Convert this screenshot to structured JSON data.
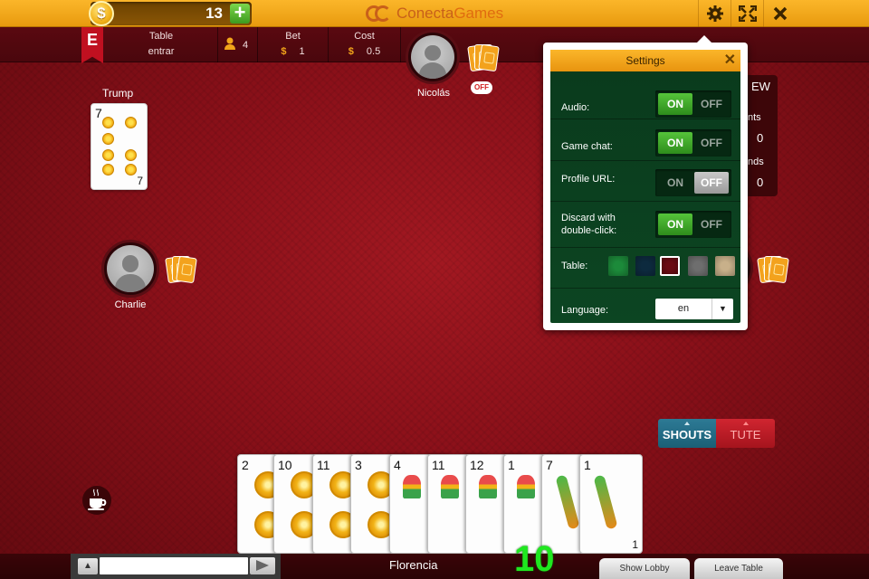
{
  "topbar": {
    "coins": "13",
    "coin_symbol": "$",
    "add_label": "+",
    "brand_part1": "Conecta",
    "brand_part2": "Games",
    "settings_icon": "gear-icon",
    "fullscreen_icon": "fullscreen-icon",
    "close_icon": "close-icon"
  },
  "infobar": {
    "badge": "E",
    "table_label": "Table",
    "table_value": "entrar",
    "players_count": "4",
    "bet_label": "Bet",
    "bet_currency": "$",
    "bet_value": "1",
    "cost_label": "Cost",
    "cost_currency": "$",
    "cost_value": "0.5"
  },
  "trump": {
    "label": "Trump",
    "card_number": "7",
    "suit": "oros"
  },
  "players": {
    "top": {
      "name": "Nicolás",
      "status_bubble": "OFF"
    },
    "left": {
      "name": "Charlie"
    },
    "bottom": {
      "name": "Florencia"
    }
  },
  "scoreboard": {
    "header": "EW",
    "row1_label": "nts",
    "row1_value": "0",
    "row2_label": "nds",
    "row2_value": "0"
  },
  "settings": {
    "title": "Settings",
    "close_label": "✕",
    "on_label": "ON",
    "off_label": "OFF",
    "rows": [
      {
        "label": "Audio:",
        "state": "on"
      },
      {
        "label": "Game chat:",
        "state": "on"
      },
      {
        "label": "Profile URL:",
        "state": "off"
      },
      {
        "label": "Discard with double-click:",
        "state": "on"
      }
    ],
    "table_label": "Table:",
    "table_colors": [
      "#1c8a3a",
      "#0d2a3e",
      "#6a0a12",
      "#6e6e6e",
      "#c8b08a"
    ],
    "table_selected": 2,
    "language_label": "Language:",
    "language_value": "en"
  },
  "shouts": {
    "shouts_label": "SHOUTS",
    "tute_label": "TUTE"
  },
  "hand": [
    {
      "number": "2",
      "suit": "oros"
    },
    {
      "number": "10",
      "suit": "oros"
    },
    {
      "number": "11",
      "suit": "oros"
    },
    {
      "number": "3",
      "suit": "oros"
    },
    {
      "number": "4",
      "suit": "copas"
    },
    {
      "number": "11",
      "suit": "copas"
    },
    {
      "number": "12",
      "suit": "copas"
    },
    {
      "number": "1",
      "suit": "copas"
    },
    {
      "number": "7",
      "suit": "bastos"
    },
    {
      "number": "1",
      "suit": "bastos"
    }
  ],
  "last_card_corner": "1",
  "timer": "10",
  "bottombar": {
    "chat_up_label": "▲",
    "chat_placeholder": "",
    "show_lobby": "Show Lobby",
    "leave_table": "Leave Table"
  }
}
